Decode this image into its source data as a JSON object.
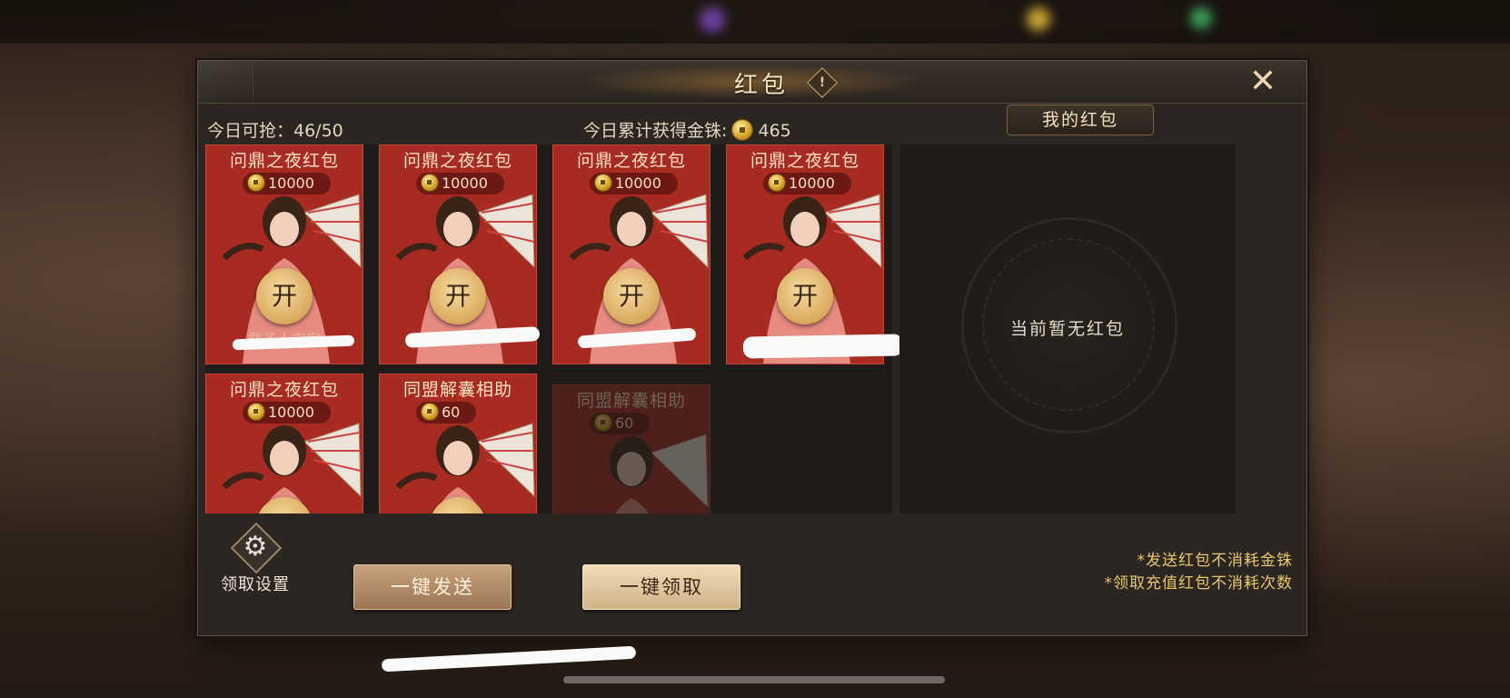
{
  "header": {
    "title": "红包",
    "info_icon": "!",
    "close_label": "✕"
  },
  "stats": {
    "remaining_label": "今日可抢：46/50",
    "gold_label": "今日累计获得金铢:",
    "gold_value": "465"
  },
  "side": {
    "tab_label": "我的红包",
    "empty_text": "当前暂无红包"
  },
  "cards": [
    {
      "title": "问鼎之夜红包",
      "amount": "10000",
      "open": "开",
      "sender": "载予人安安"
    },
    {
      "title": "问鼎之夜红包",
      "amount": "10000",
      "open": "开",
      "sender": ""
    },
    {
      "title": "问鼎之夜红包",
      "amount": "10000",
      "open": "开",
      "sender": ""
    },
    {
      "title": "问鼎之夜红包",
      "amount": "10000",
      "open": "开",
      "sender": ""
    },
    {
      "title": "问鼎之夜红包",
      "amount": "10000",
      "open": "",
      "sender": ""
    },
    {
      "title": "同盟解囊相助",
      "amount": "60",
      "open": "",
      "sender": ""
    },
    {
      "title": "同盟解囊相助",
      "amount": "60",
      "open": "",
      "sender": ""
    }
  ],
  "bottom": {
    "settings_label": "领取设置",
    "send_all": "一键发送",
    "claim_all": "一键领取",
    "note_1": "*发送红包不消耗金铢",
    "note_2": "*领取充值红包不消耗次数"
  },
  "colors": {
    "card_red": "#a82b22",
    "accent_gold": "#d9aa5e",
    "note_yellow": "#e8c86a"
  }
}
